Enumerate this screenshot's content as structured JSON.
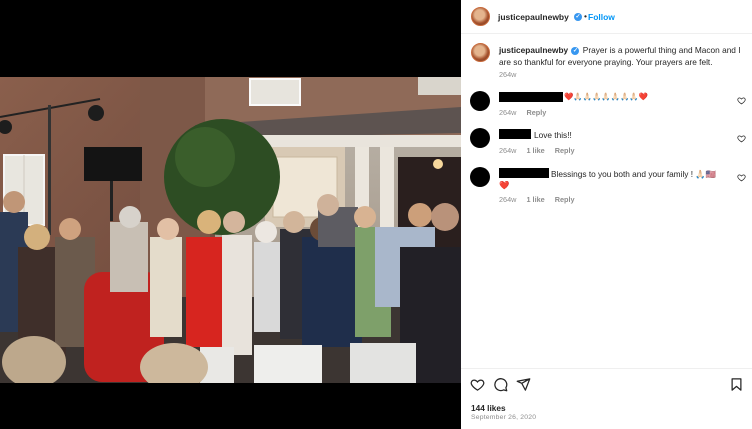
{
  "post": {
    "username": "justicepaulnewby",
    "dot": "•",
    "follow_label": "Follow",
    "caption": "Prayer is a powerful thing and Macon and I are so thankful for everyone praying. Your prayers are felt.",
    "caption_age": "264w",
    "likes": "144 likes",
    "date": "September 26, 2020"
  },
  "comments": [
    {
      "text": "❤️🙏🏻🙏🏻🙏🏻🙏🏻🙏🏻🙏🏻🙏🏻❤️",
      "age": "264w",
      "likes": "",
      "reply": "Reply"
    },
    {
      "text": "Love this!!",
      "age": "264w",
      "likes": "1 like",
      "reply": "Reply"
    },
    {
      "text": "Blessings to you both and your family ! 🙏🏻🇺🇸",
      "text2": "❤️",
      "age": "264w",
      "likes": "1 like",
      "reply": "Reply"
    }
  ],
  "icons": {
    "like": "heart-icon",
    "comment": "comment-icon",
    "share": "share-icon",
    "save": "bookmark-icon"
  },
  "colors": {
    "accent": "#0095f6",
    "verified": "#3897f0",
    "muted": "#8e8e8e"
  }
}
